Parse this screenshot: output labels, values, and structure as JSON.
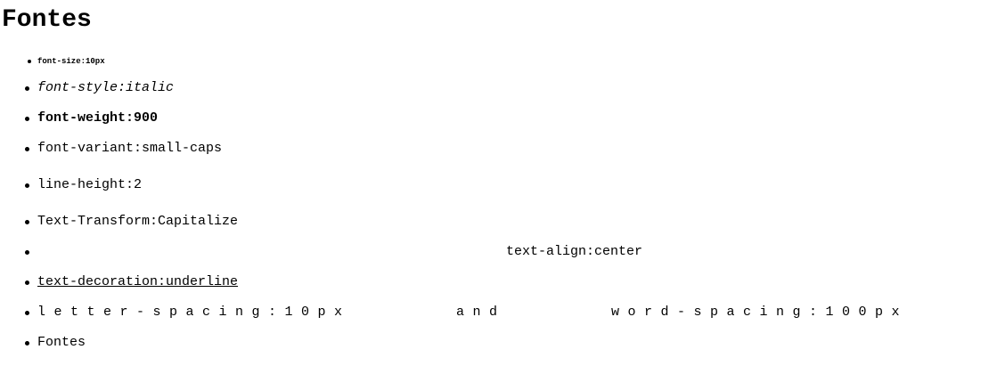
{
  "page": {
    "title": "Fontes"
  },
  "items": [
    {
      "label": "font-size:10px"
    },
    {
      "label": "font-style:italic"
    },
    {
      "label": "font-weight:900"
    },
    {
      "label": "font-variant:small-caps"
    },
    {
      "label": "line-height:2"
    },
    {
      "label": "Text-Transform:Capitalize"
    },
    {
      "label": "text-align:center"
    },
    {
      "label": "text-decoration:underline"
    },
    {
      "label": "letter-spacing:10px and word-spacing:100px"
    },
    {
      "label": "Fontes"
    }
  ]
}
